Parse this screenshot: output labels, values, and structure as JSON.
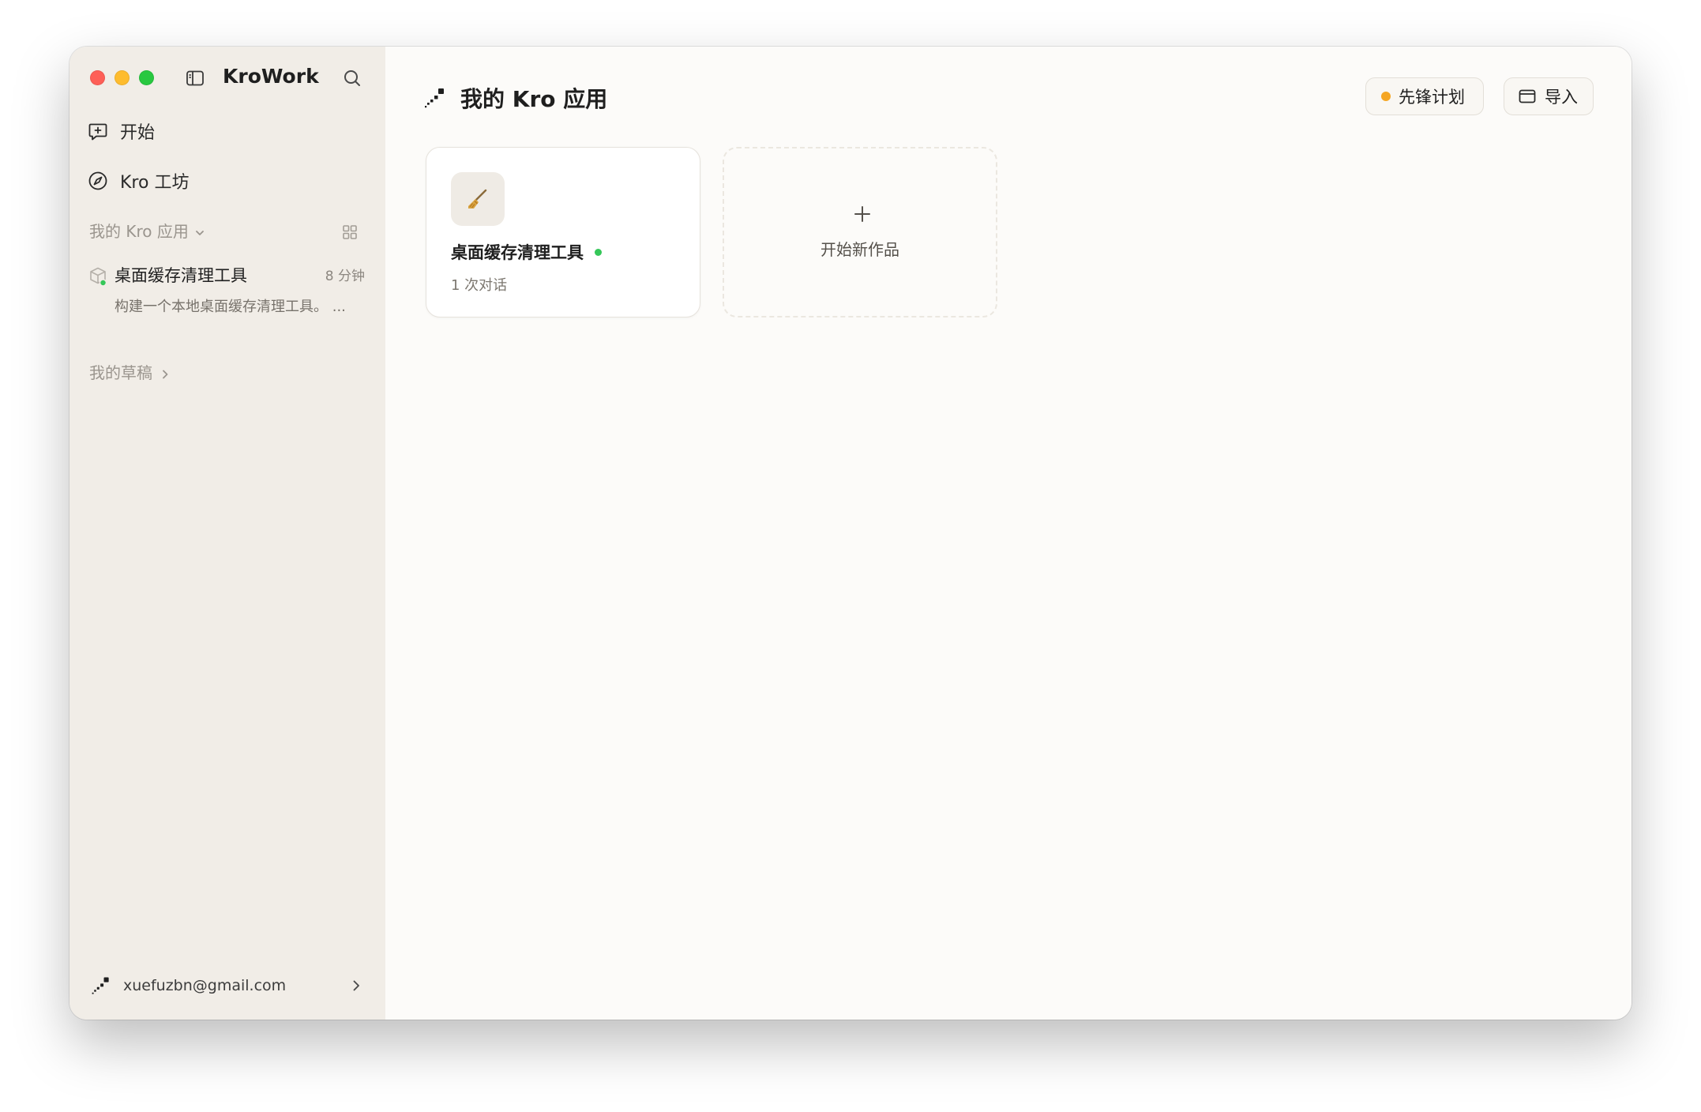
{
  "window": {
    "title": "KroWork"
  },
  "sidebar": {
    "nav": [
      {
        "label": "开始",
        "icon": "chat-plus-icon"
      },
      {
        "label": "Kro 工坊",
        "icon": "compass-icon"
      }
    ],
    "apps_section": {
      "label": "我的 Kro 应用",
      "apps": [
        {
          "name": "桌面缓存清理工具",
          "time": "8 分钟",
          "description": "构建一个本地桌面缓存清理工具。 ..."
        }
      ]
    },
    "drafts_label": "我的草稿",
    "account": {
      "email": "xuefuzbn@gmail.com"
    }
  },
  "main": {
    "title": "我的 Kro 应用",
    "pioneer_button": "先锋计划",
    "import_button": "导入",
    "cards": [
      {
        "name": "桌面缓存清理工具",
        "subtitle": "1 次对话",
        "icon": "broom-icon",
        "status": "active"
      }
    ],
    "new_card_label": "开始新作品"
  },
  "colors": {
    "sidebar_bg": "#f1ede7",
    "main_bg": "#fcfbf9",
    "status_green": "#35c759",
    "pioneer_dot": "#f5a623"
  }
}
